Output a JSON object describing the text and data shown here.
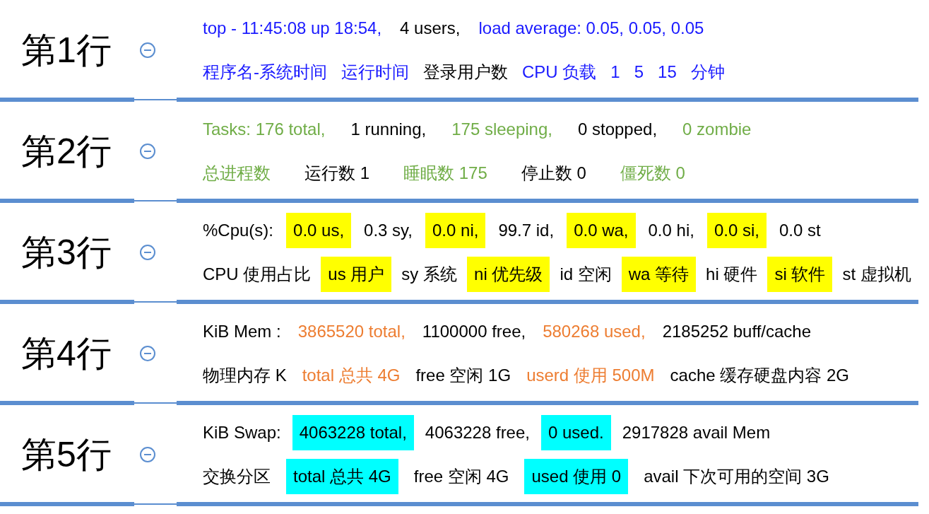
{
  "sections": [
    {
      "label": "第1行",
      "expanded": true,
      "lines": [
        [
          {
            "kind": "plain",
            "text": "top - 11:45:08 up 18:54,",
            "color": "#1a1aff"
          },
          {
            "kind": "plain",
            "text": "4 users,",
            "color": "#000000"
          },
          {
            "kind": "plain",
            "text": "load average: 0.05, 0.05, 0.05",
            "color": "#1a1aff"
          }
        ],
        [
          {
            "kind": "plain",
            "text": "程序名-系统时间",
            "color": "#1a1aff"
          },
          {
            "kind": "plain",
            "text": "运行时间",
            "color": "#1a1aff"
          },
          {
            "kind": "plain",
            "text": "登录用户数",
            "color": "#000000"
          },
          {
            "kind": "plain",
            "text": "CPU 负载",
            "color": "#1a1aff"
          },
          {
            "kind": "plain",
            "text": "1",
            "color": "#1a1aff"
          },
          {
            "kind": "plain",
            "text": "5",
            "color": "#1a1aff"
          },
          {
            "kind": "plain",
            "text": "15",
            "color": "#1a1aff"
          },
          {
            "kind": "plain",
            "text": "分钟",
            "color": "#1a1aff"
          }
        ]
      ]
    },
    {
      "label": "第2行",
      "expanded": true,
      "lines": [
        [
          {
            "kind": "plain",
            "text": "Tasks: 176 total,",
            "color": "#70ad47"
          },
          {
            "kind": "plain",
            "text": "1 running,",
            "color": "#000000"
          },
          {
            "kind": "plain",
            "text": "175 sleeping,",
            "color": "#70ad47"
          },
          {
            "kind": "plain",
            "text": "0 stopped,",
            "color": "#000000"
          },
          {
            "kind": "plain",
            "text": "0 zombie",
            "color": "#70ad47"
          }
        ],
        [
          {
            "kind": "plain",
            "text": "总进程数",
            "color": "#70ad47"
          },
          {
            "kind": "plain",
            "text": "运行数 1",
            "color": "#000000"
          },
          {
            "kind": "plain",
            "text": "睡眠数 175",
            "color": "#70ad47"
          },
          {
            "kind": "plain",
            "text": "停止数 0",
            "color": "#000000"
          },
          {
            "kind": "plain",
            "text": "僵死数 0",
            "color": "#70ad47"
          }
        ]
      ]
    },
    {
      "label": "第3行",
      "expanded": true,
      "lines": [
        [
          {
            "kind": "plain",
            "text": "%Cpu(s):",
            "color": "#000000"
          },
          {
            "kind": "highlighted",
            "text": "0.0 us,",
            "color": "#ffff00"
          },
          {
            "kind": "plain",
            "text": "0.3 sy,",
            "color": "#000000"
          },
          {
            "kind": "highlighted",
            "text": "0.0 ni,",
            "color": "#ffff00"
          },
          {
            "kind": "plain",
            "text": "99.7 id,",
            "color": "#000000"
          },
          {
            "kind": "highlighted",
            "text": "0.0 wa,",
            "color": "#ffff00"
          },
          {
            "kind": "plain",
            "text": "0.0 hi,",
            "color": "#000000"
          },
          {
            "kind": "highlighted",
            "text": "0.0 si,",
            "color": "#ffff00"
          },
          {
            "kind": "plain",
            "text": "0.0 st",
            "color": "#000000"
          }
        ],
        [
          {
            "kind": "plain",
            "text": "CPU 使用占比",
            "color": "#000000"
          },
          {
            "kind": "highlighted",
            "text": "us 用户",
            "color": "#ffff00"
          },
          {
            "kind": "plain",
            "text": "sy 系统",
            "color": "#000000"
          },
          {
            "kind": "highlighted",
            "text": "ni 优先级",
            "color": "#ffff00"
          },
          {
            "kind": "plain",
            "text": "id 空闲",
            "color": "#000000"
          },
          {
            "kind": "highlighted",
            "text": "wa 等待",
            "color": "#ffff00"
          },
          {
            "kind": "plain",
            "text": "hi 硬件",
            "color": "#000000"
          },
          {
            "kind": "highlighted",
            "text": "si 软件",
            "color": "#ffff00"
          },
          {
            "kind": "plain",
            "text": "st 虚拟机",
            "color": "#000000"
          }
        ]
      ]
    },
    {
      "label": "第4行",
      "expanded": true,
      "lines": [
        [
          {
            "kind": "plain",
            "text": "KiB Mem :",
            "color": "#000000"
          },
          {
            "kind": "plain",
            "text": "3865520 total,",
            "color": "#ed7d31"
          },
          {
            "kind": "plain",
            "text": "1100000 free,",
            "color": "#000000"
          },
          {
            "kind": "plain",
            "text": "580268 used,",
            "color": "#ed7d31"
          },
          {
            "kind": "plain",
            "text": "2185252 buff/cache",
            "color": "#000000"
          }
        ],
        [
          {
            "kind": "plain",
            "text": "物理内存 K",
            "color": "#000000"
          },
          {
            "kind": "plain",
            "text": "total 总共 4G",
            "color": "#ed7d31"
          },
          {
            "kind": "plain",
            "text": "free 空闲 1G",
            "color": "#000000"
          },
          {
            "kind": "plain",
            "text": "userd 使用 500M",
            "color": "#ed7d31"
          },
          {
            "kind": "plain",
            "text": "cache 缓存硬盘内容 2G",
            "color": "#000000"
          }
        ]
      ]
    },
    {
      "label": "第5行",
      "expanded": true,
      "lines": [
        [
          {
            "kind": "plain",
            "text": "KiB Swap:",
            "color": "#000000"
          },
          {
            "kind": "highlighted",
            "text": "4063228 total,",
            "color": "#00ffff"
          },
          {
            "kind": "plain",
            "text": "4063228 free,",
            "color": "#000000"
          },
          {
            "kind": "highlighted",
            "text": "0 used.",
            "color": "#00ffff"
          },
          {
            "kind": "plain",
            "text": "2917828 avail Mem",
            "color": "#000000"
          }
        ],
        [
          {
            "kind": "plain",
            "text": "交换分区",
            "color": "#000000"
          },
          {
            "kind": "highlighted",
            "text": "total 总共 4G",
            "color": "#00ffff"
          },
          {
            "kind": "plain",
            "text": "free 空闲 4G",
            "color": "#000000"
          },
          {
            "kind": "highlighted",
            "text": "used 使用 0",
            "color": "#00ffff"
          },
          {
            "kind": "plain",
            "text": "avail 下次可用的空间 3G",
            "color": "#000000"
          }
        ]
      ]
    }
  ]
}
